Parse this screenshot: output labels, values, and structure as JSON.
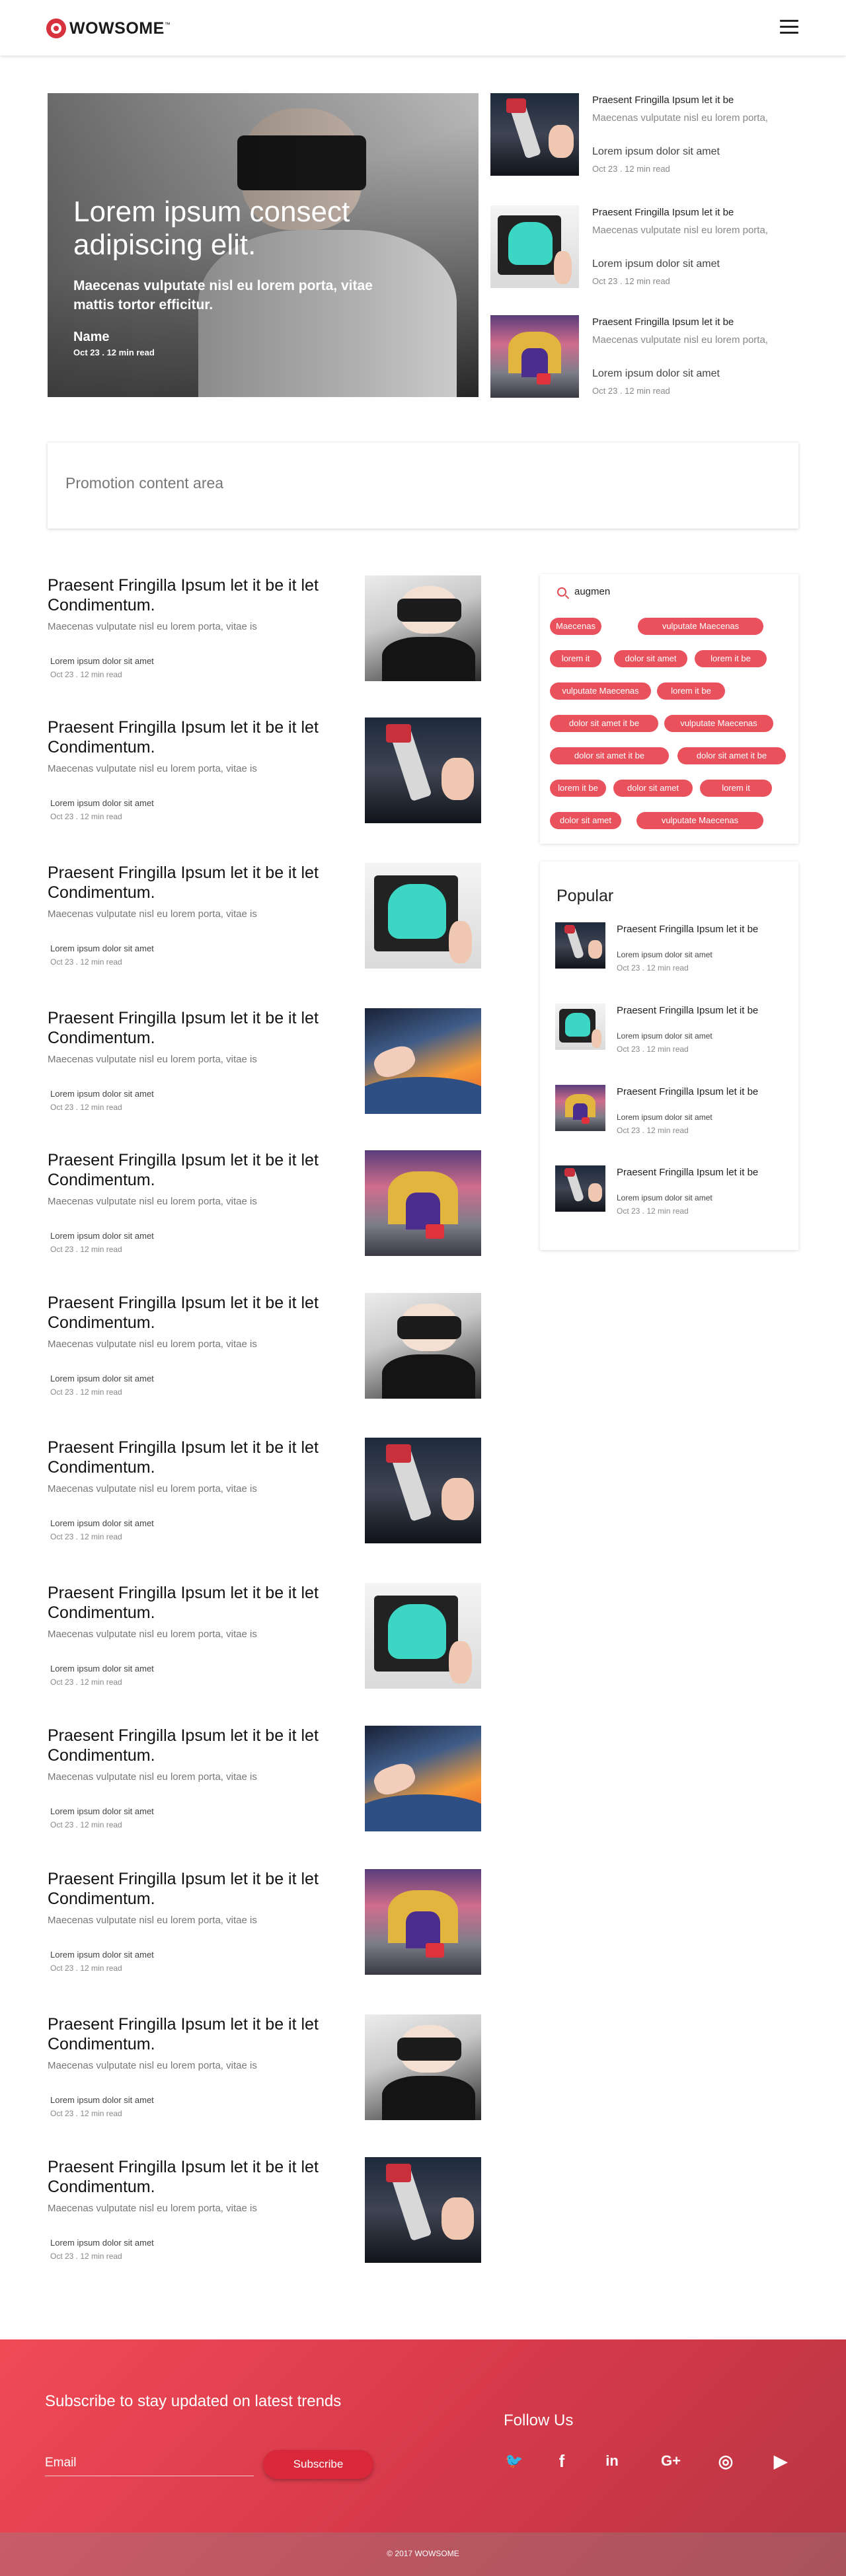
{
  "header": {
    "logo_text": "WOWSOME",
    "logo_suffix": "™"
  },
  "hero": {
    "title": "Lorem ipsum consect adipiscing elit.",
    "subtitle": "Maecenas vulputate nisl eu lorem porta, vitae mattis tortor efficitur.",
    "author": "Name",
    "meta": "Oct 23 . 12 min read"
  },
  "side_stories": [
    {
      "title": "Praesent Fringilla Ipsum let it be",
      "desc": "Maecenas vulputate nisl eu lorem porta,",
      "sub": "Lorem ipsum dolor sit amet",
      "meta": "Oct 23 . 12 min read",
      "image": "robot-arm"
    },
    {
      "title": "Praesent Fringilla Ipsum let it be",
      "desc": "Maecenas vulputate nisl eu lorem porta,",
      "sub": "Lorem ipsum dolor sit amet",
      "meta": "Oct 23 . 12 min read",
      "image": "teal-robot-tablet"
    },
    {
      "title": "Praesent Fringilla Ipsum let it be",
      "desc": "Maecenas vulputate nisl eu lorem porta,",
      "sub": "Lorem ipsum dolor sit amet",
      "meta": "Oct 23 . 12 min read",
      "image": "street-scene"
    }
  ],
  "promo": {
    "text": "Promotion content area"
  },
  "articles": [
    {
      "title": "Praesent Fringilla Ipsum let it be it let Condimentum.",
      "desc": "Maecenas vulputate nisl eu lorem porta, vitae is",
      "sub": "Lorem ipsum dolor sit amet",
      "meta": "Oct 23 . 12 min read",
      "image": "vr-headset"
    },
    {
      "title": "Praesent Fringilla Ipsum let it be it let Condimentum.",
      "desc": "Maecenas vulputate nisl eu lorem porta, vitae is",
      "sub": "Lorem ipsum dolor sit amet",
      "meta": "Oct 23 . 12 min read",
      "image": "robot-arm"
    },
    {
      "title": "Praesent Fringilla Ipsum let it be it let Condimentum.",
      "desc": "Maecenas vulputate nisl eu lorem porta, vitae is",
      "sub": "Lorem ipsum dolor sit amet",
      "meta": "Oct 23 . 12 min read",
      "image": "teal-robot-tablet"
    },
    {
      "title": "Praesent Fringilla Ipsum let it be it let Condimentum.",
      "desc": "Maecenas vulputate nisl eu lorem porta, vitae is",
      "sub": "Lorem ipsum dolor sit amet",
      "meta": "Oct 23 . 12 min read",
      "image": "sky-hand"
    },
    {
      "title": "Praesent Fringilla Ipsum let it be it let Condimentum.",
      "desc": "Maecenas vulputate nisl eu lorem porta, vitae is",
      "sub": "Lorem ipsum dolor sit amet",
      "meta": "Oct 23 . 12 min read",
      "image": "street-scene"
    },
    {
      "title": "Praesent Fringilla Ipsum let it be it let Condimentum.",
      "desc": "Maecenas vulputate nisl eu lorem porta, vitae is",
      "sub": "Lorem ipsum dolor sit amet",
      "meta": "Oct 23 . 12 min read",
      "image": "vr-headset"
    },
    {
      "title": "Praesent Fringilla Ipsum let it be it let Condimentum.",
      "desc": "Maecenas vulputate nisl eu lorem porta, vitae is",
      "sub": "Lorem ipsum dolor sit amet",
      "meta": "Oct 23 . 12 min read",
      "image": "robot-arm"
    },
    {
      "title": "Praesent Fringilla Ipsum let it be it let Condimentum.",
      "desc": "Maecenas vulputate nisl eu lorem porta, vitae is",
      "sub": "Lorem ipsum dolor sit amet",
      "meta": "Oct 23 . 12 min read",
      "image": "teal-robot-tablet"
    },
    {
      "title": "Praesent Fringilla Ipsum let it be it let Condimentum.",
      "desc": "Maecenas vulputate nisl eu lorem porta, vitae is",
      "sub": "Lorem ipsum dolor sit amet",
      "meta": "Oct 23 . 12 min read",
      "image": "sky-hand"
    },
    {
      "title": "Praesent Fringilla Ipsum let it be it let Condimentum.",
      "desc": "Maecenas vulputate nisl eu lorem porta, vitae is",
      "sub": "Lorem ipsum dolor sit amet",
      "meta": "Oct 23 . 12 min read",
      "image": "street-scene"
    },
    {
      "title": "Praesent Fringilla Ipsum let it be it let Condimentum.",
      "desc": "Maecenas vulputate nisl eu lorem porta, vitae is",
      "sub": "Lorem ipsum dolor sit amet",
      "meta": "Oct 23 . 12 min read",
      "image": "vr-headset"
    },
    {
      "title": "Praesent Fringilla Ipsum let it be it let Condimentum.",
      "desc": "Maecenas vulputate nisl eu lorem porta, vitae is",
      "sub": "Lorem ipsum dolor sit amet",
      "meta": "Oct 23 . 12 min read",
      "image": "robot-arm"
    }
  ],
  "sidebar": {
    "search_value": "augmen",
    "tags": [
      "Maecenas",
      "vulputate Maecenas",
      "lorem it",
      "dolor sit amet",
      "lorem it be",
      "vulputate Maecenas",
      "lorem it be",
      "dolor sit amet it be",
      "vulputate Maecenas",
      "dolor sit amet it be",
      "dolor sit amet it be",
      "lorem it be",
      "dolor sit amet",
      "lorem it",
      "dolor sit amet",
      "vulputate Maecenas"
    ],
    "tag_color": "#e9515c"
  },
  "popular": {
    "heading": "Popular",
    "items": [
      {
        "title": "Praesent Fringilla Ipsum let it be",
        "sub": "Lorem ipsum dolor sit amet",
        "meta": "Oct 23 . 12 min read",
        "image": "robot-arm"
      },
      {
        "title": "Praesent Fringilla Ipsum let it be",
        "sub": "Lorem ipsum dolor sit amet",
        "meta": "Oct 23 . 12 min read",
        "image": "teal-robot-tablet"
      },
      {
        "title": "Praesent Fringilla Ipsum let it be",
        "sub": "Lorem ipsum dolor sit amet",
        "meta": "Oct 23 . 12 min read",
        "image": "street-scene"
      },
      {
        "title": "Praesent Fringilla Ipsum let it be",
        "sub": "Lorem ipsum dolor sit amet",
        "meta": "Oct 23 . 12 min read",
        "image": "robot-arm"
      }
    ]
  },
  "footer": {
    "subscribe_heading": "Subscribe to stay updated on latest trends",
    "email_label": "Email",
    "subscribe_button": "Subscribe",
    "follow_heading": "Follow Us",
    "social_icons": [
      {
        "name": "twitter-icon",
        "glyph": "🐦"
      },
      {
        "name": "facebook-icon",
        "glyph": "f"
      },
      {
        "name": "linkedin-icon",
        "glyph": "in"
      },
      {
        "name": "google-plus-icon",
        "glyph": "G+"
      },
      {
        "name": "instagram-icon",
        "glyph": "◎"
      },
      {
        "name": "youtube-icon",
        "glyph": "▶"
      }
    ],
    "copyright": "© 2017 WOWSOME",
    "accent": "#e9515c"
  }
}
